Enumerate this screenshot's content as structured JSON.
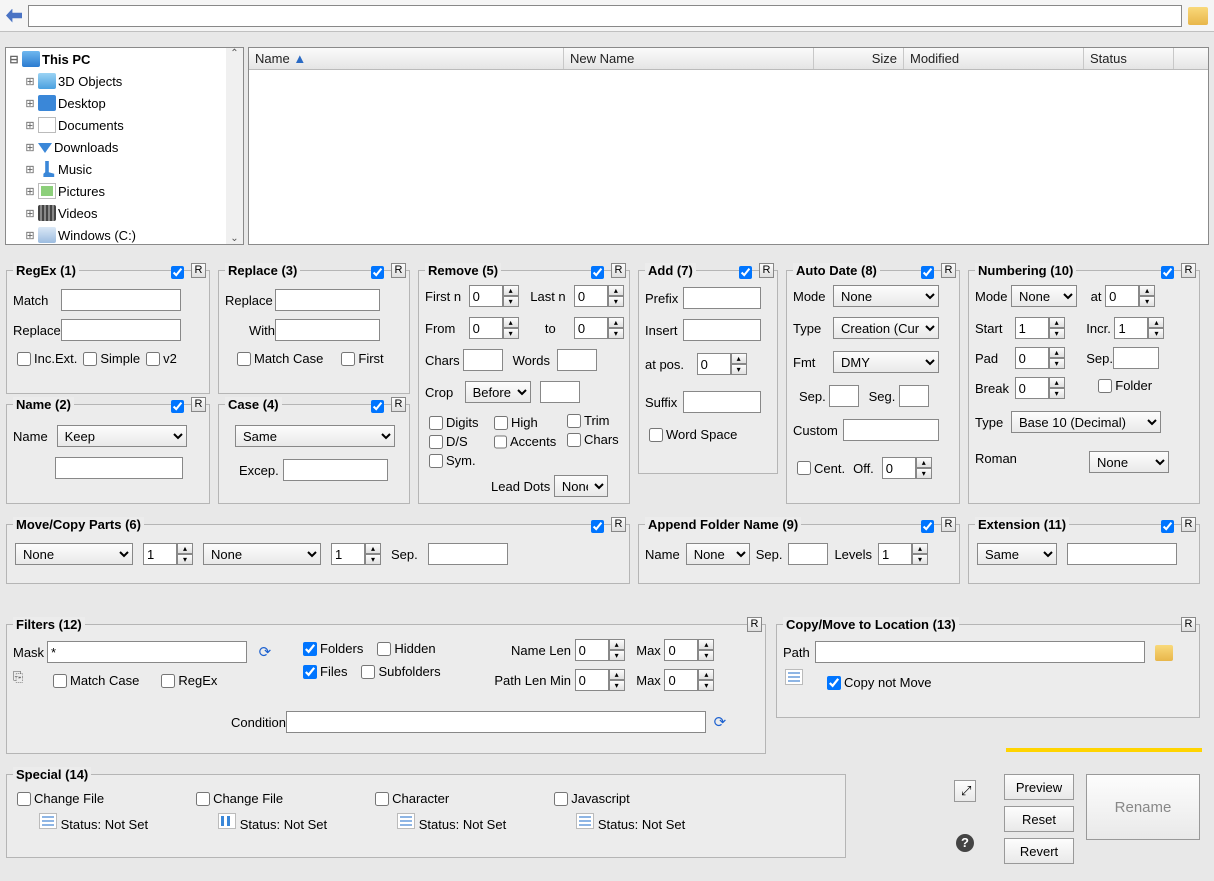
{
  "tree": {
    "root": "This PC",
    "items": [
      {
        "label": "3D Objects",
        "icon": "box3d"
      },
      {
        "label": "Desktop",
        "icon": "desk"
      },
      {
        "label": "Documents",
        "icon": "doc"
      },
      {
        "label": "Downloads",
        "icon": "dl"
      },
      {
        "label": "Music",
        "icon": "mus"
      },
      {
        "label": "Pictures",
        "icon": "pic"
      },
      {
        "label": "Videos",
        "icon": "vid"
      },
      {
        "label": "Windows (C:)",
        "icon": "drv"
      }
    ]
  },
  "list_cols": [
    "Name",
    "New Name",
    "Size",
    "Modified",
    "Status"
  ],
  "p1": {
    "title": "RegEx (1)",
    "match": "Match",
    "replace": "Replace",
    "inc": "Inc.Ext.",
    "simple": "Simple",
    "v2": "v2"
  },
  "p2": {
    "title": "Name (2)",
    "name": "Name",
    "keep": "Keep"
  },
  "p3": {
    "title": "Replace (3)",
    "replace": "Replace",
    "with": "With",
    "mc": "Match Case",
    "first": "First"
  },
  "p4": {
    "title": "Case (4)",
    "same": "Same",
    "excep": "Excep."
  },
  "p5": {
    "title": "Remove (5)",
    "firstn": "First n",
    "lastn": "Last n",
    "from": "From",
    "to": "to",
    "chars": "Chars",
    "words": "Words",
    "crop": "Crop",
    "before": "Before",
    "digits": "Digits",
    "high": "High",
    "ds": "D/S",
    "accents": "Accents",
    "sym": "Sym.",
    "lead": "Lead Dots",
    "none": "None",
    "trim": "Trim",
    "chars2": "Chars"
  },
  "p6": {
    "title": "Move/Copy Parts (6)",
    "none": "None",
    "sep": "Sep."
  },
  "p7": {
    "title": "Add (7)",
    "prefix": "Prefix",
    "insert": "Insert",
    "at": "at pos.",
    "suffix": "Suffix",
    "ws": "Word Space"
  },
  "p8": {
    "title": "Auto Date (8)",
    "mode": "Mode",
    "none": "None",
    "type": "Type",
    "creation": "Creation (Cur",
    "fmt": "Fmt",
    "dmy": "DMY",
    "sep": "Sep.",
    "seg": "Seg.",
    "custom": "Custom",
    "cent": "Cent.",
    "off": "Off."
  },
  "p9": {
    "title": "Append Folder Name (9)",
    "name": "Name",
    "none": "None",
    "sep": "Sep.",
    "levels": "Levels"
  },
  "p10": {
    "title": "Numbering (10)",
    "mode": "Mode",
    "none": "None",
    "at": "at",
    "start": "Start",
    "incr": "Incr.",
    "pad": "Pad",
    "sep": "Sep.",
    "break": "Break",
    "folder": "Folder",
    "type": "Type",
    "base": "Base 10 (Decimal)",
    "roman": "Roman",
    "none2": "None"
  },
  "p11": {
    "title": "Extension (11)",
    "same": "Same"
  },
  "p12": {
    "title": "Filters (12)",
    "mask": "Mask",
    "maskval": "*",
    "mc": "Match Case",
    "regex": "RegEx",
    "folders": "Folders",
    "files": "Files",
    "hidden": "Hidden",
    "sub": "Subfolders",
    "nlen": "Name Len",
    "plen": "Path Len Min",
    "max": "Max",
    "cond": "Condition"
  },
  "p13": {
    "title": "Copy/Move to Location (13)",
    "path": "Path",
    "copy": "Copy not Move"
  },
  "p14": {
    "title": "Special (14)",
    "cf": "Change File",
    "chr": "Character",
    "js": "Javascript",
    "st": "Status: Not Set"
  },
  "btns": {
    "preview": "Preview",
    "reset": "Reset",
    "revert": "Revert",
    "rename": "Rename"
  },
  "zero": "0",
  "one": "1",
  "r": "R"
}
